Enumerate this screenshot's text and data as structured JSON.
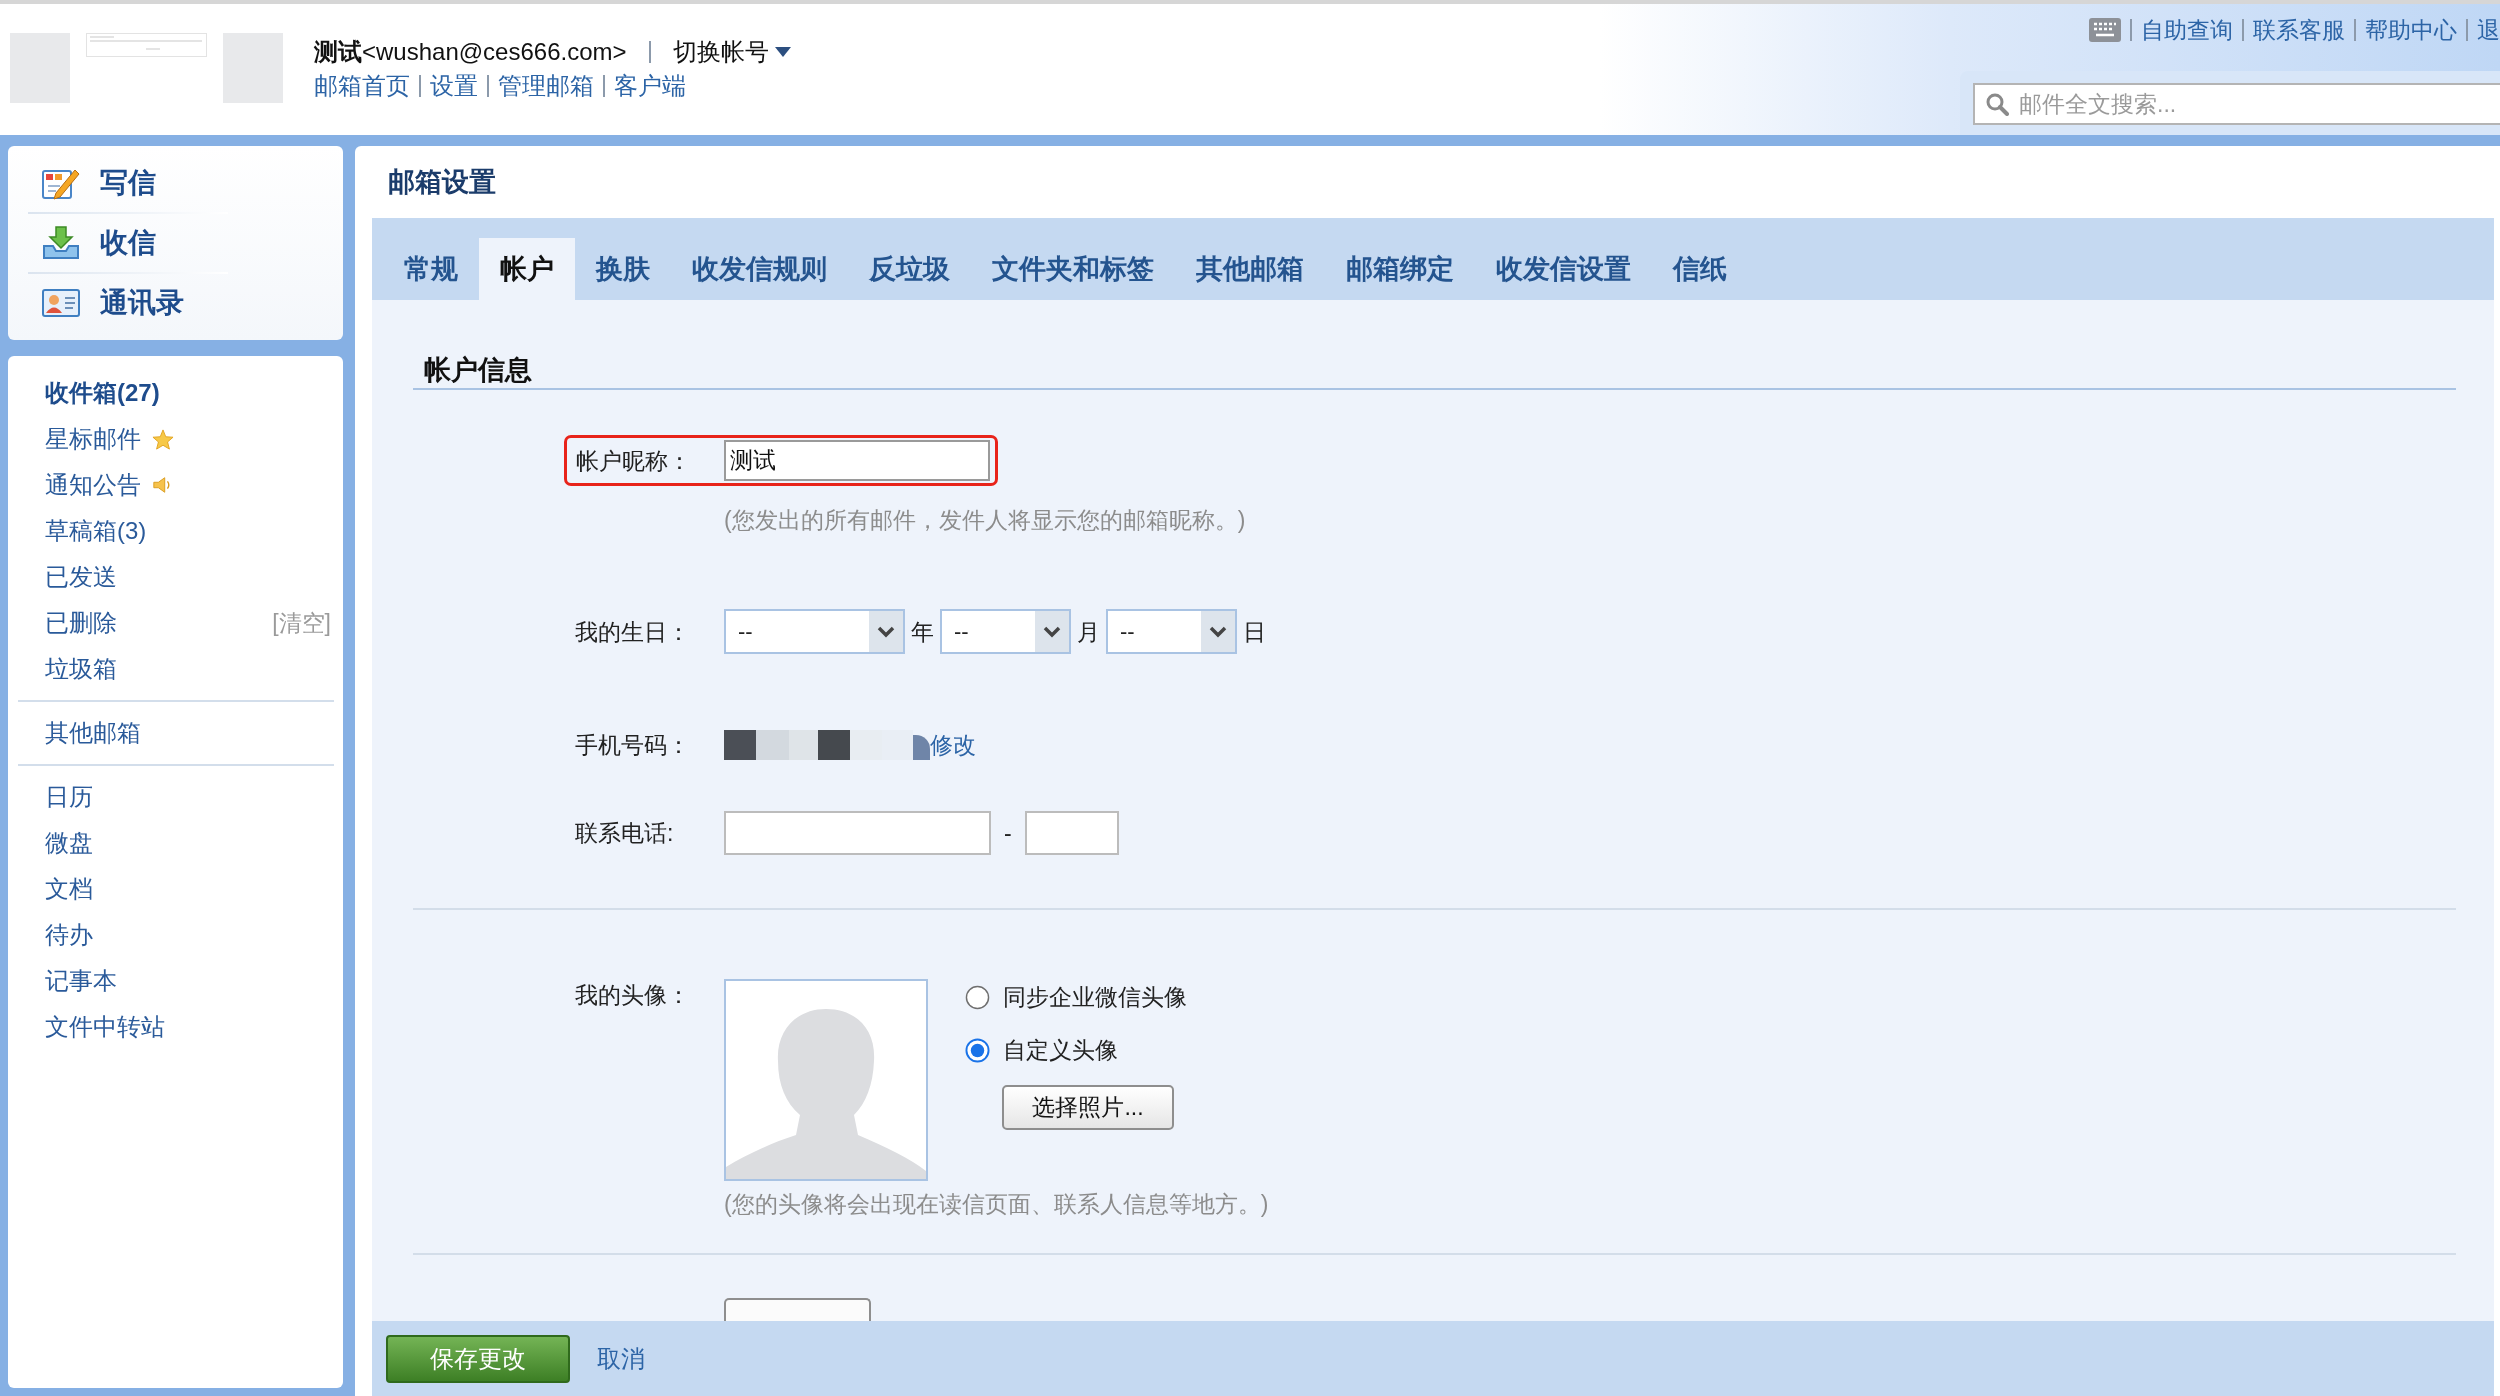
{
  "header": {
    "account": "**测试**<wushan@ces666.com>",
    "switch_account": "切换帐号",
    "links": [
      "邮箱首页",
      "设置",
      "管理邮箱",
      "客户端"
    ],
    "top_links": [
      "自助查询",
      "联系客服",
      "帮助中心",
      "退"
    ],
    "search": {
      "placeholder": "邮件全文搜索..."
    }
  },
  "sidebar": {
    "actions": [
      {
        "kind": "compose",
        "label": "写信"
      },
      {
        "kind": "inbox",
        "label": "收信"
      },
      {
        "kind": "contacts",
        "label": "通讯录"
      }
    ],
    "groups": [
      {
        "items": [
          {
            "label": "收件箱(27)",
            "kind": "plain",
            "unread": true
          },
          {
            "label": "星标邮件",
            "kind": "starred",
            "unread": false
          },
          {
            "label": "通知公告",
            "kind": "notice",
            "unread": false
          },
          {
            "label": "草稿箱(3)",
            "kind": "plain",
            "unread": false
          },
          {
            "label": "已发送",
            "kind": "plain",
            "unread": false
          },
          {
            "label": "已删除",
            "kind": "plain",
            "unread": false,
            "action": "[清空]"
          },
          {
            "label": "垃圾箱",
            "kind": "plain",
            "unread": false
          }
        ]
      },
      {
        "items": [
          {
            "label": "其他邮箱",
            "kind": "plain",
            "unread": false
          }
        ]
      },
      {
        "items": [
          {
            "label": "日历",
            "kind": "plain",
            "unread": false
          },
          {
            "label": "微盘",
            "kind": "plain",
            "unread": false
          },
          {
            "label": "文档",
            "kind": "plain",
            "unread": false
          },
          {
            "label": "待办",
            "kind": "plain",
            "unread": false
          },
          {
            "label": "记事本",
            "kind": "plain",
            "unread": false
          },
          {
            "label": "文件中转站",
            "kind": "plain",
            "unread": false
          }
        ]
      }
    ]
  },
  "settings": {
    "title": "邮箱设置",
    "tabs": [
      {
        "label": "常规",
        "selected": false
      },
      {
        "label": "帐户",
        "selected": true
      },
      {
        "label": "换肤",
        "selected": false
      },
      {
        "label": "收发信规则",
        "selected": false
      },
      {
        "label": "反垃圾",
        "selected": false
      },
      {
        "label": "文件夹和标签",
        "selected": false
      },
      {
        "label": "其他邮箱",
        "selected": false
      },
      {
        "label": "邮箱绑定",
        "selected": false
      },
      {
        "label": "收发信设置",
        "selected": false
      },
      {
        "label": "信纸",
        "selected": false
      }
    ],
    "section_title": "帐户信息",
    "nickname": {
      "label": "帐户昵称：",
      "value": "测试",
      "highlighted": true,
      "hint": "(您发出的所有邮件，发件人将显示您的邮箱昵称。)"
    },
    "birthday": {
      "label": "我的生日：",
      "selects": [
        {
          "value": "--",
          "unit": "年"
        },
        {
          "value": "--",
          "unit": "月"
        },
        {
          "value": "--",
          "unit": "日"
        }
      ]
    },
    "mobile": {
      "label": "手机号码：",
      "edit_link": "修改"
    },
    "phone": {
      "label": "联系电话:",
      "separator": "-"
    },
    "avatar": {
      "label": "我的头像：",
      "options": [
        {
          "label": "同步企业微信头像",
          "selected": false
        },
        {
          "label": "自定义头像",
          "selected": true
        }
      ],
      "choose_button": "选择照片...",
      "hint": "(您的头像将会出现在读信页面、联系人信息等地方。)"
    }
  },
  "footer": {
    "save": "保存更改",
    "cancel": "取消"
  }
}
